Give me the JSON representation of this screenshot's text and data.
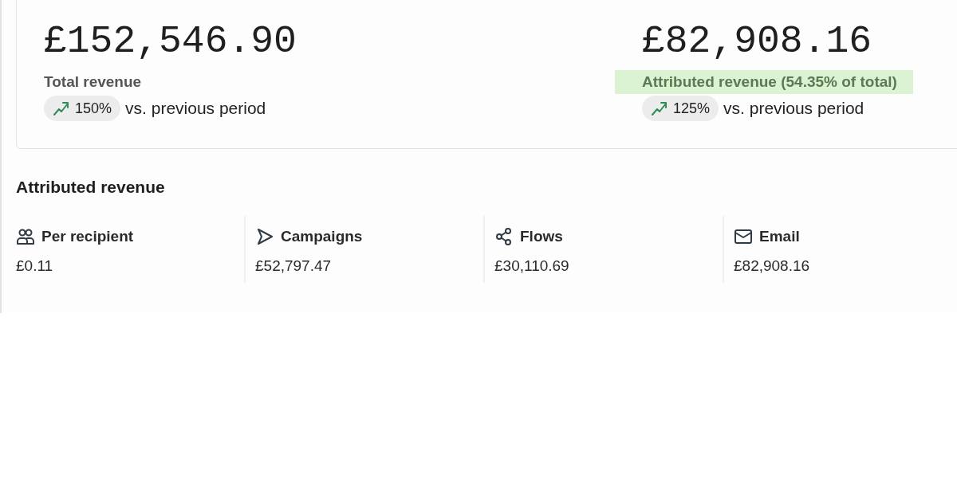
{
  "summary": [
    {
      "amount": "£152,546.90",
      "label": "Total revenue",
      "highlighted": false,
      "change": "150%",
      "rising": true,
      "comparison": "vs. previous period"
    },
    {
      "amount": "£82,908.16",
      "label": "Attributed revenue (54.35% of total)",
      "highlighted": true,
      "change": "125%",
      "rising": true,
      "comparison": "vs. previous period"
    }
  ],
  "section": {
    "title": "Attributed revenue"
  },
  "metrics": [
    {
      "kind": "people",
      "label": "Per recipient",
      "value": "£0.11"
    },
    {
      "kind": "send",
      "label": "Campaigns",
      "value": "£52,797.47"
    },
    {
      "kind": "flows",
      "label": "Flows",
      "value": "£30,110.69"
    },
    {
      "kind": "email",
      "label": "Email",
      "value": "£82,908.16"
    }
  ]
}
